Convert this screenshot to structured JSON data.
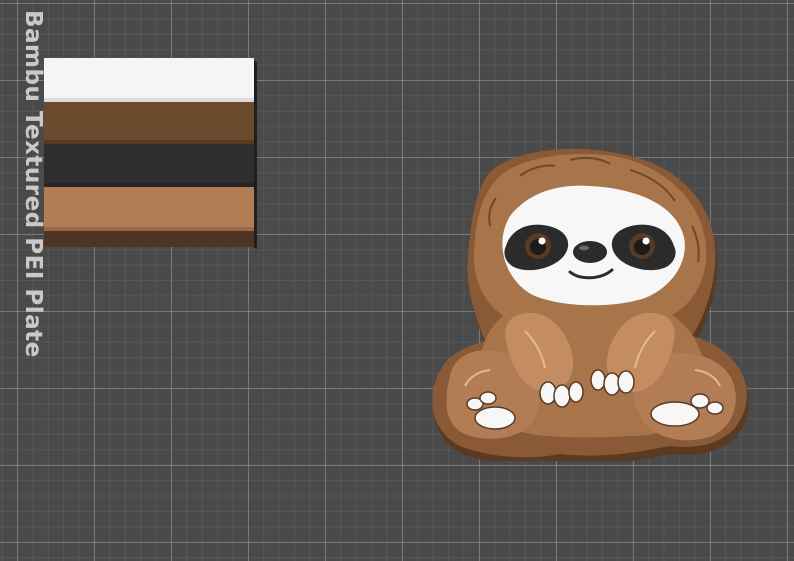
{
  "plate": {
    "label": "Bambu Textured PEI Plate",
    "background_color": "#4a4a4a",
    "grid_color": "#969696"
  },
  "filament_swatches": [
    {
      "name": "white-layer",
      "color": "#f5f5f5",
      "side": "#d9d9d9"
    },
    {
      "name": "dark-brown-layer",
      "color": "#6b4a2e",
      "side": "#5a3d25"
    },
    {
      "name": "charcoal-layer",
      "color": "#2e2e2e",
      "side": "#262626"
    },
    {
      "name": "light-brown-layer",
      "color": "#b27d55",
      "side": "#9a6a47"
    },
    {
      "name": "base-dark-brown-layer",
      "color": "#4e3422",
      "side": "#3e2a1b"
    }
  ],
  "model": {
    "name": "sloth-figure",
    "colors": {
      "fur": "#a8744a",
      "fur_dark": "#6b4a2e",
      "fur_highlight": "#d9ab82",
      "face": "#f7f7f7",
      "mask": "#2b2b2b",
      "base": "#8a5a36",
      "base_edge": "#5a3a22"
    }
  }
}
